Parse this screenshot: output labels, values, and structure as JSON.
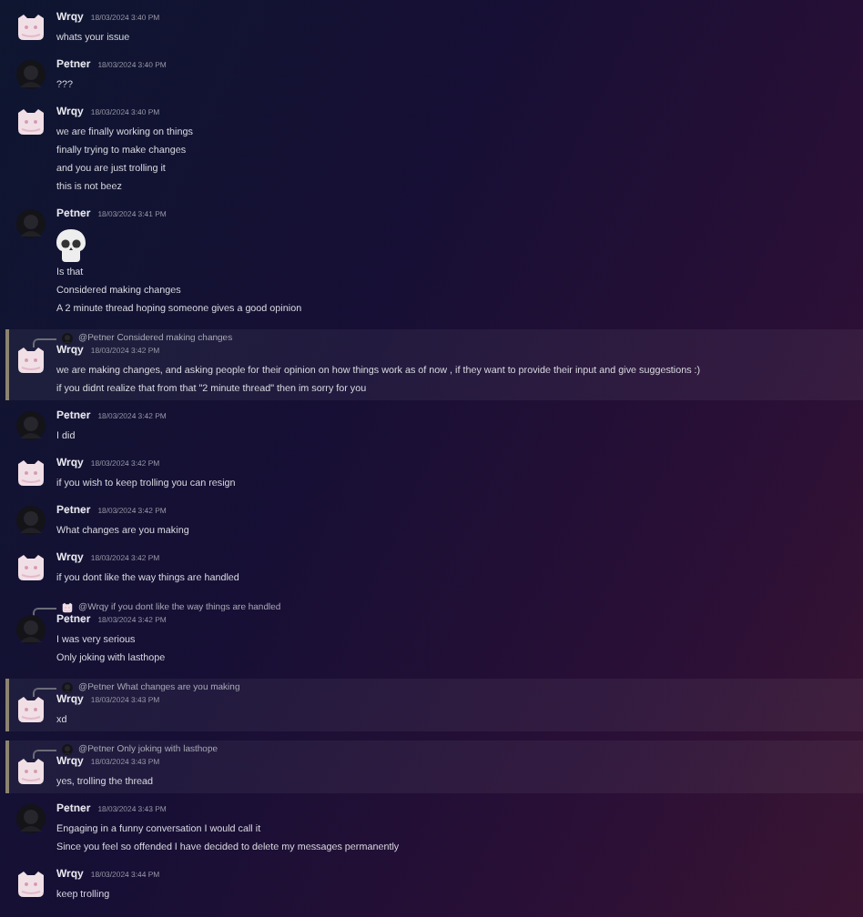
{
  "messages": [
    {
      "author": "Wrqy",
      "kind": "light",
      "time": "18/03/2024 3:40 PM",
      "highlighted": false,
      "lines": [
        "whats your issue"
      ]
    },
    {
      "author": "Petner",
      "kind": "dark",
      "time": "18/03/2024 3:40 PM",
      "highlighted": false,
      "lines": [
        "???"
      ]
    },
    {
      "author": "Wrqy",
      "kind": "light",
      "time": "18/03/2024 3:40 PM",
      "highlighted": false,
      "lines": [
        "we are finally working on things",
        "finally trying to make changes",
        "and you are just trolling it",
        "this is not beez"
      ]
    },
    {
      "author": "Petner",
      "kind": "dark",
      "time": "18/03/2024 3:41 PM",
      "highlighted": false,
      "skull": true,
      "lines": [
        "Is that",
        "Considered making changes",
        "A 2 minute thread hoping someone gives a good opinion"
      ]
    },
    {
      "author": "Wrqy",
      "kind": "light",
      "time": "18/03/2024 3:42 PM",
      "highlighted": true,
      "reply": {
        "kind": "dark",
        "text": "@Petner Considered making changes"
      },
      "lines": [
        "we are making changes, and asking people for their opinion on how things work as of now , if they want to provide their input and give suggestions :)",
        "if you didnt realize that from that \"2 minute thread\" then im sorry for you"
      ]
    },
    {
      "author": "Petner",
      "kind": "dark",
      "time": "18/03/2024 3:42 PM",
      "highlighted": false,
      "lines": [
        "I did"
      ]
    },
    {
      "author": "Wrqy",
      "kind": "light",
      "time": "18/03/2024 3:42 PM",
      "highlighted": false,
      "lines": [
        "if you wish to keep trolling you can resign"
      ]
    },
    {
      "author": "Petner",
      "kind": "dark",
      "time": "18/03/2024 3:42 PM",
      "highlighted": false,
      "lines": [
        "What changes are you making"
      ]
    },
    {
      "author": "Wrqy",
      "kind": "light",
      "time": "18/03/2024 3:42 PM",
      "highlighted": false,
      "lines": [
        "if you dont like the way things are handled"
      ]
    },
    {
      "author": "Petner",
      "kind": "dark",
      "time": "18/03/2024 3:42 PM",
      "highlighted": false,
      "reply": {
        "kind": "light",
        "text": "@Wrqy if you dont like the way things are handled"
      },
      "lines": [
        "I was very serious",
        "Only joking with lasthope"
      ]
    },
    {
      "author": "Wrqy",
      "kind": "light",
      "time": "18/03/2024 3:43 PM",
      "highlighted": true,
      "reply": {
        "kind": "dark",
        "text": "@Petner What changes are you making"
      },
      "lines": [
        "xd"
      ]
    },
    {
      "author": "Wrqy",
      "kind": "light",
      "time": "18/03/2024 3:43 PM",
      "highlighted": true,
      "reply": {
        "kind": "dark",
        "text": "@Petner Only joking with lasthope"
      },
      "lines": [
        "yes, trolling the thread"
      ]
    },
    {
      "author": "Petner",
      "kind": "dark",
      "time": "18/03/2024 3:43 PM",
      "highlighted": false,
      "lines": [
        "Engaging in a funny conversation I would call it",
        "Since you feel so offended I have decided to delete my messages permanently"
      ]
    },
    {
      "author": "Wrqy",
      "kind": "light",
      "time": "18/03/2024 3:44 PM",
      "highlighted": false,
      "lines": [
        "keep trolling"
      ]
    }
  ]
}
